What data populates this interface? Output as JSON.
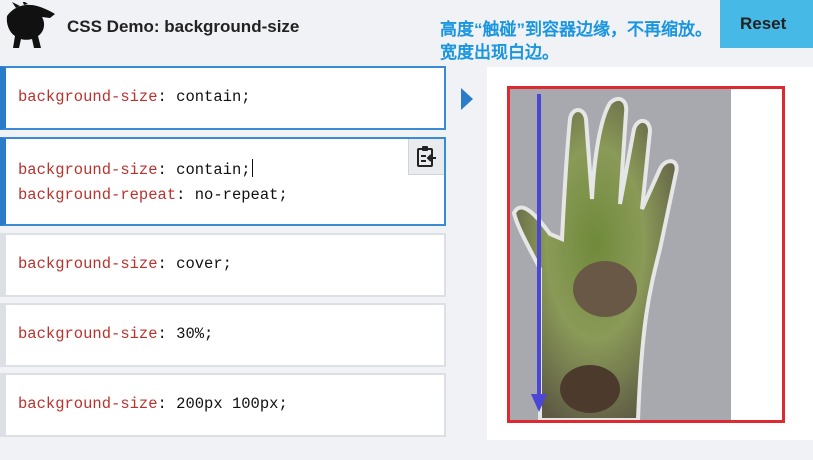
{
  "header": {
    "title": "CSS Demo: background-size",
    "reset_label": "Reset"
  },
  "annotation": {
    "line1": "高度“触碰”到容器边缘，不再缩放。",
    "line2": "宽度出现白边。"
  },
  "panels": [
    {
      "lines": [
        {
          "prop": "background-size",
          "value": "contain;"
        }
      ]
    },
    {
      "lines": [
        {
          "prop": "background-size",
          "value": "contain;"
        },
        {
          "prop": "background-repeat",
          "value": "no-repeat;"
        }
      ]
    },
    {
      "lines": [
        {
          "prop": "background-size",
          "value": "cover;"
        }
      ]
    },
    {
      "lines": [
        {
          "prop": "background-size",
          "value": "30%;"
        }
      ]
    },
    {
      "lines": [
        {
          "prop": "background-size",
          "value": "200px 100px;"
        }
      ]
    }
  ],
  "colors": {
    "accent_blue": "#2b7cc8",
    "frame_red": "#dd2a30",
    "annotation_blue": "#1a95e0",
    "arrow_blue": "#4b46d6"
  },
  "icons": {
    "logo": "dinosaur-logo",
    "copy": "clipboard-copy-icon",
    "pointer": "triangle-right-icon"
  }
}
